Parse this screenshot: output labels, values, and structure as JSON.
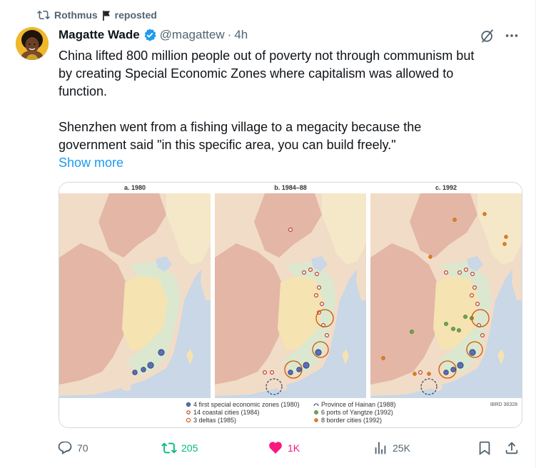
{
  "repost": {
    "user": "Rothmus",
    "label": "reposted"
  },
  "author": {
    "name": "Magatte Wade",
    "handle": "@magattew",
    "separator": "·",
    "time": "4h"
  },
  "tweet": {
    "line1": "China lifted 800 million people out of poverty not through communism but",
    "line2": "by creating Special Economic Zones where capitalism was allowed to",
    "line3": "function.",
    "line4": "Shenzhen went from a fishing village to a megacity because the",
    "line5": "government said \"in this specific area, you can build freely.\"",
    "show_more": "Show more"
  },
  "map": {
    "panels": [
      "a. 1980",
      "b. 1984–88",
      "c. 1992"
    ],
    "legend": {
      "sez": "4 first special economic zones (1980)",
      "coastal": "14 coastal cities (1984)",
      "deltas": "3 deltas (1985)",
      "hainan": "Province of Hainan (1988)",
      "yangtze": "6 ports of Yangtze (1992)",
      "border": "8 border cities (1992)"
    },
    "credit": "IBRD 36328"
  },
  "actions": {
    "replies": "70",
    "reposts": "205",
    "likes": "1K",
    "views": "25K"
  },
  "colors": {
    "accent": "#1d9bf0",
    "repost_green": "#00ba7c",
    "like_pink": "#f91880",
    "muted": "#536471"
  }
}
